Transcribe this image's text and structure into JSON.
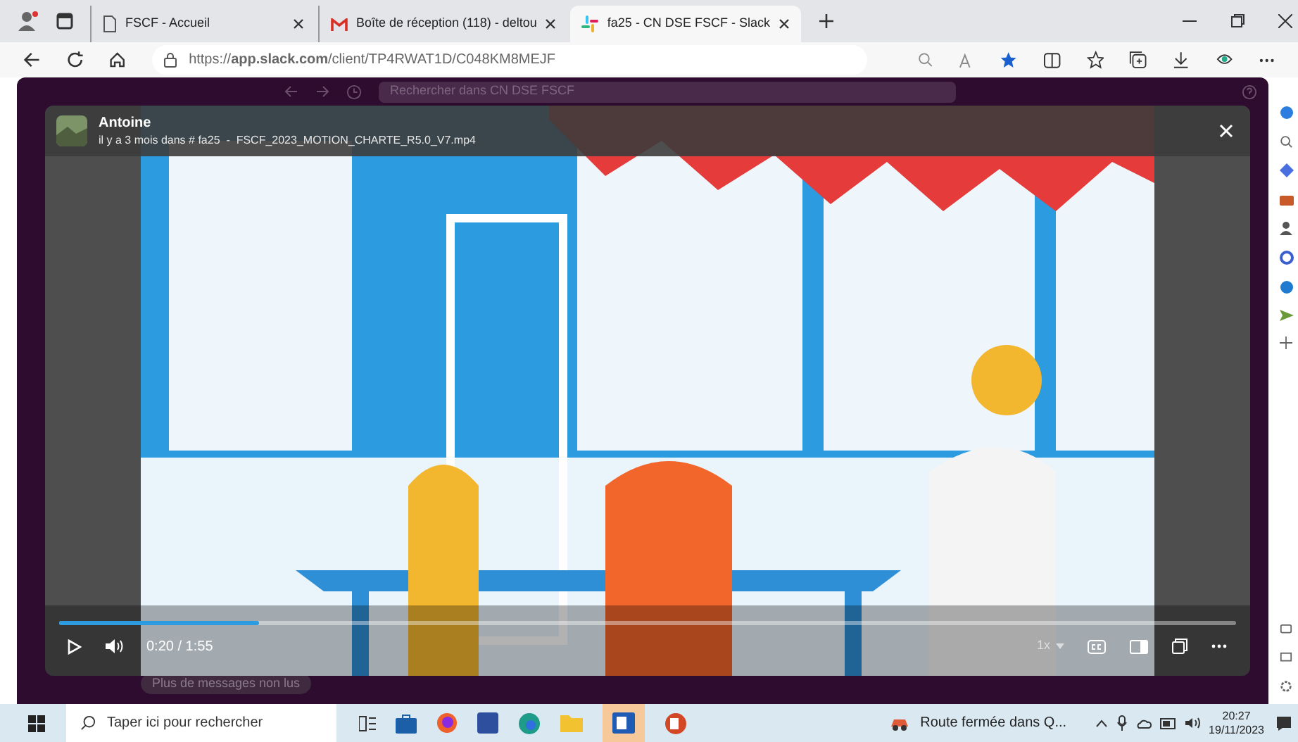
{
  "browser": {
    "tabs": [
      {
        "title": "FSCF - Accueil",
        "selected": false
      },
      {
        "title": "Boîte de réception (118) - deltou",
        "selected": false
      },
      {
        "title": "fa25 - CN DSE FSCF - Slack",
        "selected": true
      }
    ],
    "address": "https://**app.slack.com**/client/TP4RWAT1D/C048KM8MEJF"
  },
  "slack": {
    "search_placeholder": "Rechercher dans CN DSE FSCF",
    "unread_button": "Plus de messages non lus"
  },
  "video": {
    "author": "Antoine",
    "meta": "il y a 3 mois dans # fa25  -  FSCF_2023_MOTION_CHARTE_R5.0_V7.mp4",
    "time": "0:20 / 1:55",
    "speed": "1x",
    "level": 0.17
  },
  "taskbar": {
    "search_placeholder": "Taper ici pour rechercher",
    "news": "Route fermée dans Q...",
    "time": "20:27",
    "date": "19/11/2023"
  }
}
